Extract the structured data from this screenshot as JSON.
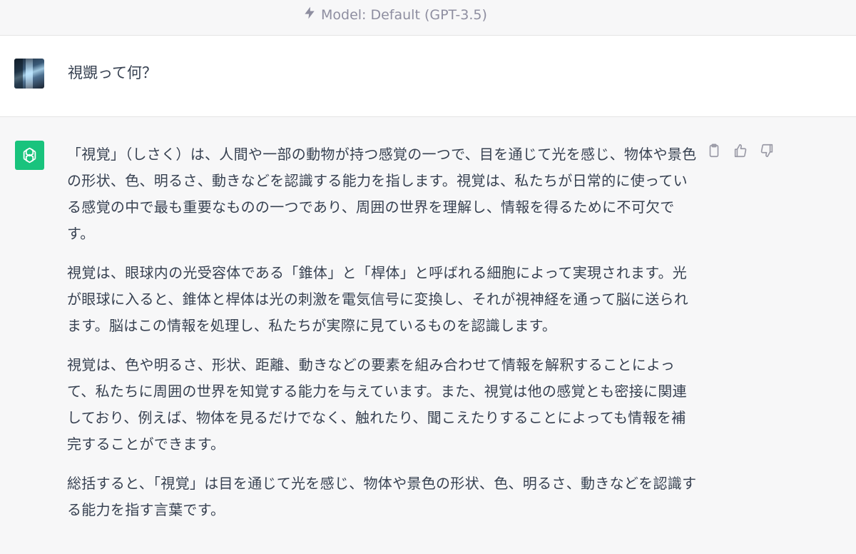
{
  "header": {
    "model_label": "Model: Default (GPT-3.5)",
    "icon": "lightning-bolt-icon"
  },
  "user_message": {
    "avatar": "user-avatar",
    "text": "視覬って何？"
  },
  "assistant_message": {
    "avatar": "openai-logo-icon",
    "paragraphs": [
      "「視覚」（しさく）は、人間や一部の動物が持つ感覚の一つで、目を通じて光を感じ、物体や景色の形状、色、明るさ、動きなどを認識する能力を指します。視覚は、私たちが日常的に使っている感覚の中で最も重要なものの一つであり、周囲の世界を理解し、情報を得るために不可欠です。",
      "視覚は、眼球内の光受容体である「錐体」と「桿体」と呼ばれる細胞によって実現されます。光が眼球に入ると、錐体と桿体は光の刺激を電気信号に変換し、それが視神経を通って脳に送られます。脳はこの情報を処理し、私たちが実際に見ているものを認識します。",
      "視覚は、色や明るさ、形状、距離、動きなどの要素を組み合わせて情報を解釈することによって、私たちに周囲の世界を知覚する能力を与えています。また、視覚は他の感覚とも密接に関連しており、例えば、物体を見るだけでなく、触れたり、聞こえたりすることによっても情報を補完することができます。",
      "総括すると、「視覚」は目を通じて光を感じ、物体や景色の形状、色、明るさ、動きなどを認識する能力を指す言葉です。"
    ],
    "actions": [
      "clipboard-icon",
      "thumbs-up-icon",
      "thumbs-down-icon"
    ]
  },
  "colors": {
    "accent": "#19c37d",
    "text": "#374151",
    "muted": "#8e8ea0",
    "assistant_bg": "#f7f7f8"
  }
}
